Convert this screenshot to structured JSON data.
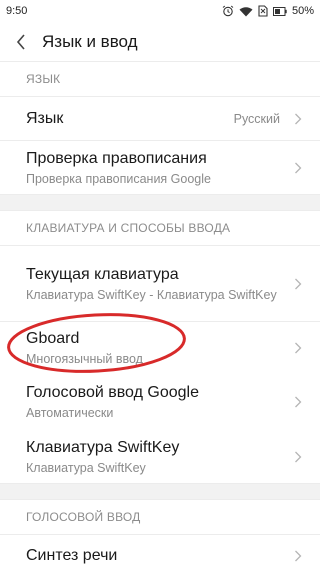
{
  "status": {
    "time": "9:50",
    "battery": "50%",
    "icons": [
      "alarm-icon",
      "wifi-icon",
      "sim-icon",
      "battery-icon"
    ]
  },
  "header": {
    "title": "Язык и ввод",
    "back_icon": "back-arrow-icon"
  },
  "sections": {
    "language_header": "ЯЗЫК",
    "keyboard_header": "КЛАВИАТУРА И СПОСОБЫ ВВОДА",
    "voice_header": "ГОЛОСОВОЙ ВВОД"
  },
  "items": {
    "language": {
      "title": "Язык",
      "value": "Русский"
    },
    "spellcheck": {
      "title": "Проверка правописания",
      "summary": "Проверка правописания Google"
    },
    "current_keyboard": {
      "title": "Текущая клавиатура",
      "summary": "Клавиатура SwiftKey - Клавиатура SwiftKey"
    },
    "gboard": {
      "title": "Gboard",
      "summary": "Многоязычный ввод"
    },
    "google_voice": {
      "title": "Голосовой ввод Google",
      "summary": "Автоматически"
    },
    "swiftkey": {
      "title": "Клавиатура SwiftKey",
      "summary": "Клавиатура SwiftKey"
    },
    "tts": {
      "title": "Синтез речи"
    }
  },
  "colors": {
    "highlight": "#d82a2a",
    "divider": "#ececec",
    "section_gap": "#f2f2f2",
    "secondary_text": "#8a8a8a"
  }
}
